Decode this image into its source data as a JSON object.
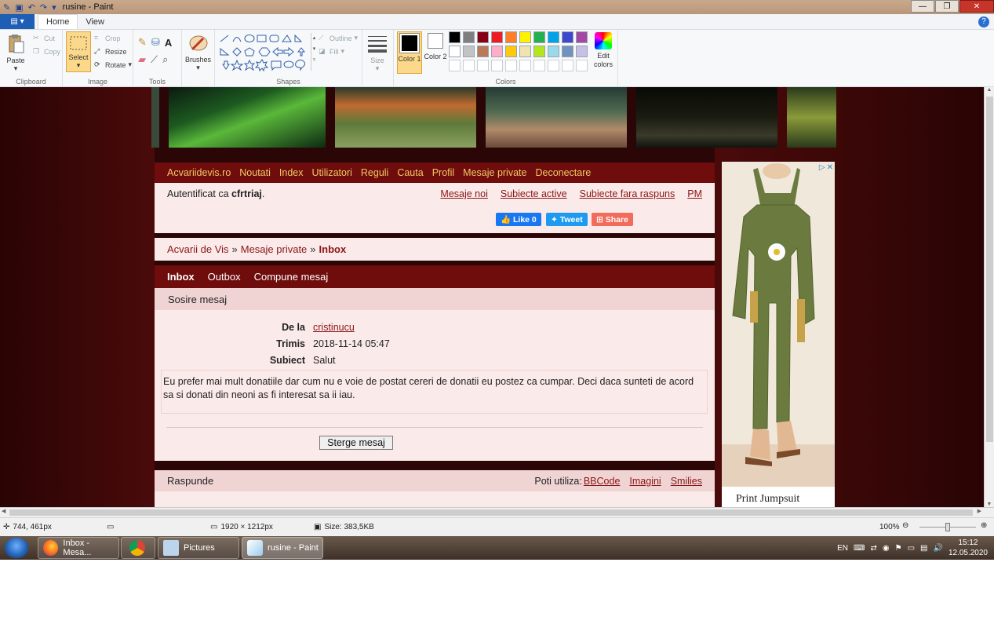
{
  "window": {
    "title": "rusine - Paint",
    "buttons": {
      "minimize": "—",
      "maximize": "❐",
      "close": "✕"
    }
  },
  "ribbon": {
    "file_tab": "▤ ▾",
    "tabs": [
      {
        "label": "Home",
        "active": true
      },
      {
        "label": "View",
        "active": false
      }
    ],
    "help": "?",
    "clipboard": {
      "label": "Clipboard",
      "paste": "Paste",
      "cut": "Cut",
      "copy": "Copy"
    },
    "image": {
      "label": "Image",
      "select": "Select",
      "crop": "Crop",
      "resize": "Resize",
      "rotate": "Rotate"
    },
    "tools": {
      "label": "Tools"
    },
    "brushes": {
      "label": "Brushes"
    },
    "shapes": {
      "label": "Shapes",
      "outline": "Outline",
      "fill": "Fill"
    },
    "size": {
      "label": "Size"
    },
    "colors": {
      "label": "Colors",
      "color1": "Color 1",
      "color2": "Color 2",
      "edit": "Edit colors",
      "palette_row1": [
        "#000000",
        "#7f7f7f",
        "#880015",
        "#ed1c24",
        "#ff7f27",
        "#fff200",
        "#22b14c",
        "#00a2e8",
        "#3f48cc",
        "#a349a4"
      ],
      "palette_row2": [
        "#ffffff",
        "#c3c3c3",
        "#b97a57",
        "#ffaec9",
        "#ffc90e",
        "#efe4b0",
        "#b5e61d",
        "#99d9ea",
        "#7092be",
        "#c8bfe7"
      ]
    }
  },
  "site": {
    "nav": [
      "Acvariidevis.ro",
      "Noutati",
      "Index",
      "Utilizatori",
      "Reguli",
      "Cauta",
      "Profil",
      "Mesaje private",
      "Deconectare"
    ],
    "auth_prefix": "Autentificat ca",
    "auth_user": "cfrtriaj",
    "auth_suffix": ".",
    "quick_links": [
      "Mesaje noi",
      "Subiecte active",
      "Subiecte fara raspuns",
      "PM"
    ],
    "social": {
      "like": "Like 0",
      "tweet": "Tweet",
      "share": "Share"
    },
    "breadcrumb": {
      "home": "Acvarii de Vis",
      "sep": "»",
      "pm": "Mesaje private",
      "current": "Inbox"
    },
    "pm_tabs": [
      {
        "label": "Inbox",
        "active": true
      },
      {
        "label": "Outbox",
        "active": false
      },
      {
        "label": "Compune mesaj",
        "active": false
      }
    ],
    "message": {
      "header": "Sosire mesaj",
      "from_label": "De la",
      "from_value": "cristinucu",
      "sent_label": "Trimis",
      "sent_value": "2018-11-14 05:47",
      "subject_label": "Subiect",
      "subject_value": "Salut",
      "body": "Eu prefer mai mult donatiile dar cum nu e voie de postat cereri de donatii eu postez ca cumpar. Deci daca sunteti de acord sa si donati din neoni as fi interesat sa ii iau.",
      "delete_button": "Sterge mesaj"
    },
    "reply": {
      "header": "Raspunde",
      "can_use": "Poti utiliza:",
      "bbcode": "BBCode",
      "images": "Imagini",
      "smilies": "Smilies"
    },
    "ad": {
      "footer": "Print Jumpsuit",
      "close": "✕"
    }
  },
  "statusbar": {
    "cursor": "744, 461px",
    "dimensions": "1920 × 1212px",
    "size": "Size: 383,5KB",
    "zoom": "100%",
    "zoom_level": 0.5
  },
  "taskbar": {
    "tasks": [
      {
        "label": "Inbox - Mesa...",
        "active": false
      },
      {
        "label": "",
        "active": false
      },
      {
        "label": "Pictures",
        "active": false
      },
      {
        "label": "rusine - Paint",
        "active": true
      }
    ],
    "language": "EN",
    "time": "15:12",
    "date": "12.05.2020"
  }
}
